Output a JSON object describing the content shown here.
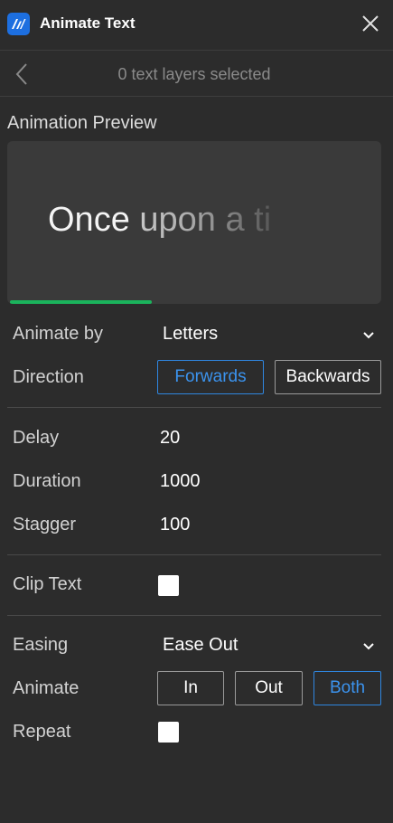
{
  "header": {
    "title": "Animate Text",
    "logo_icon": "animate-logo-icon",
    "close_icon": "close-icon",
    "brand_color": "#1d6fe0"
  },
  "subheader": {
    "back_icon": "chevron-left-icon",
    "status": "0 text layers selected"
  },
  "preview": {
    "title": "Animation Preview",
    "text": "Once upon a ti",
    "progress": 0.38,
    "progress_color": "#1bb35c"
  },
  "animate_by": {
    "label": "Animate by",
    "value": "Letters"
  },
  "direction": {
    "label": "Direction",
    "options": [
      "Forwards",
      "Backwards"
    ],
    "selected": "Forwards"
  },
  "timing": {
    "delay": {
      "label": "Delay",
      "value": "20"
    },
    "duration": {
      "label": "Duration",
      "value": "1000"
    },
    "stagger": {
      "label": "Stagger",
      "value": "100"
    }
  },
  "clip_text": {
    "label": "Clip Text",
    "checked": false
  },
  "easing": {
    "label": "Easing",
    "value": "Ease Out"
  },
  "animate": {
    "label": "Animate",
    "options": [
      "In",
      "Out",
      "Both"
    ],
    "selected": "Both"
  },
  "repeat": {
    "label": "Repeat",
    "checked": false
  },
  "accent_color": "#3b93ee"
}
